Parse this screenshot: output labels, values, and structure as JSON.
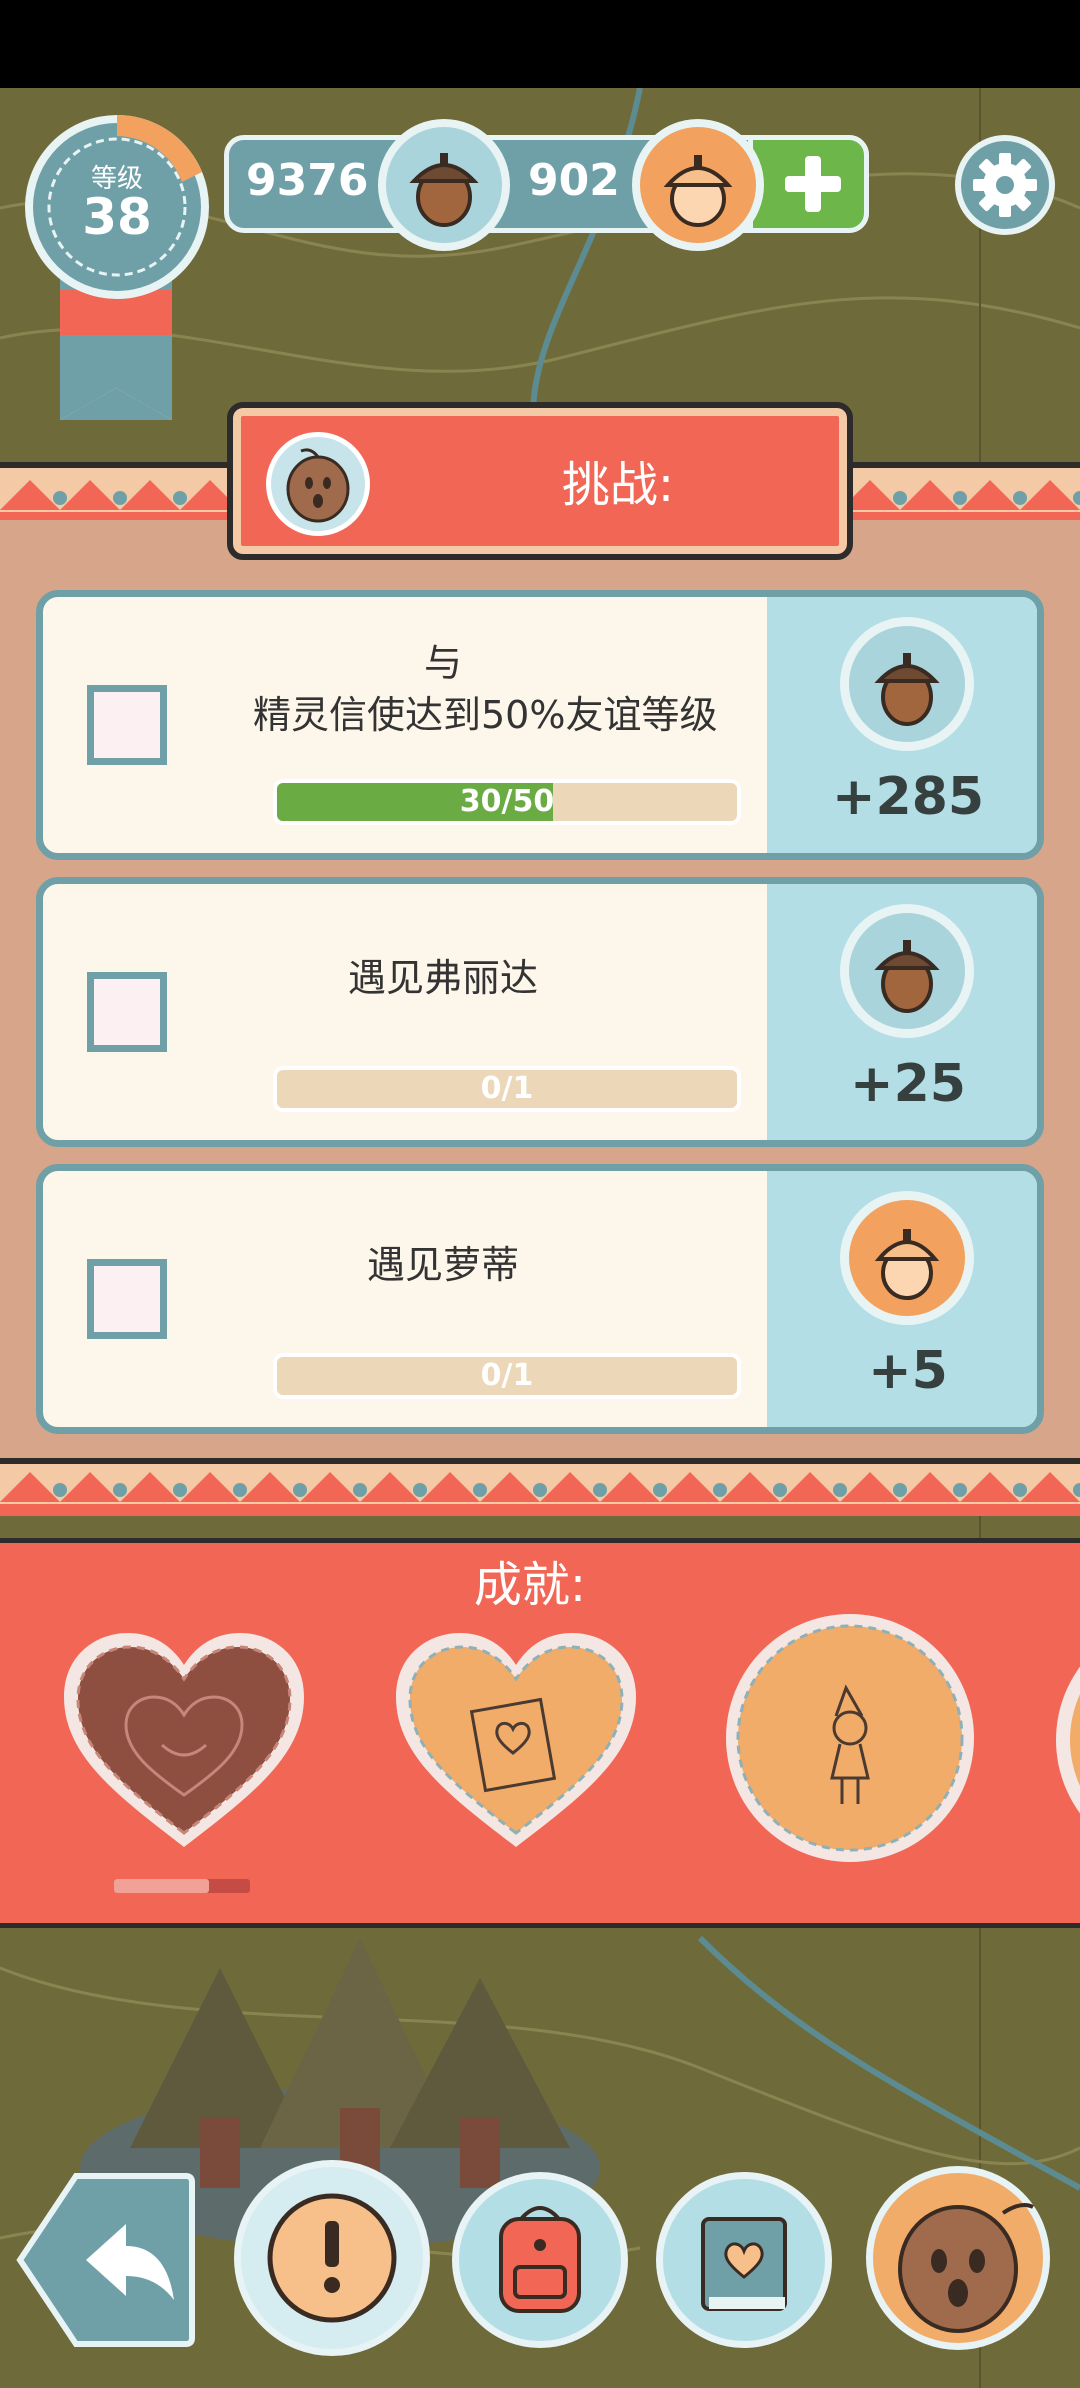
{
  "header": {
    "level_label": "等级",
    "level_value": "38",
    "acorns": "9376",
    "gold_acorns": "902"
  },
  "challenges": {
    "title": "挑战:",
    "items": [
      {
        "desc_line1": "与",
        "desc_line2": "精灵信使达到50%友谊等级",
        "progress_text": "30/50",
        "progress_fraction": 0.6,
        "reward": "+285",
        "reward_type": "acorn-icon"
      },
      {
        "desc_line1": "遇见弗丽达",
        "progress_text": "0/1",
        "progress_fraction": 0,
        "reward": "+25",
        "reward_type": "acorn-icon"
      },
      {
        "desc_line1": "遇见萝蒂",
        "progress_text": "0/1",
        "progress_fraction": 0,
        "reward": "+5",
        "reward_type": "gold-acorn-icon"
      }
    ]
  },
  "achievements": {
    "title": "成就:",
    "items": [
      "smiling-heart-badge",
      "heart-book-badge",
      "elf-badge"
    ],
    "first_progress_fraction": 0.7
  },
  "nav": [
    "back-arrow-icon",
    "exclamation-icon",
    "backpack-icon",
    "heart-book-icon",
    "walnut-character-icon"
  ],
  "colors": {
    "teal": "#6fa0a8",
    "coral": "#f26656",
    "cream": "#fdf6ea",
    "green": "#6aac43",
    "gold": "#f2a25e"
  }
}
